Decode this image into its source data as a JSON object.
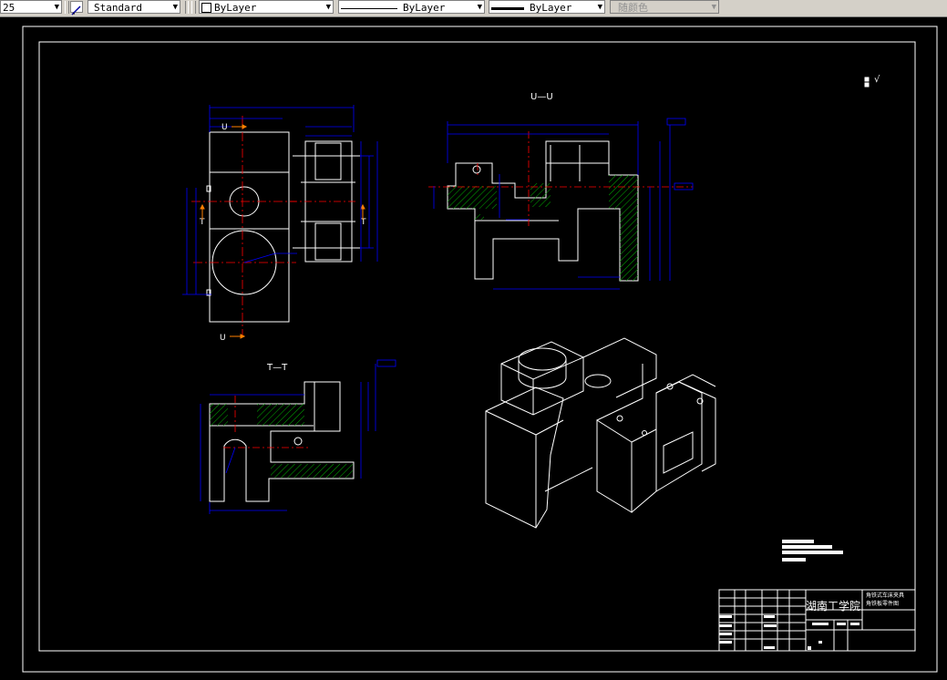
{
  "toolbar": {
    "scale_value": "25",
    "text_style": "Standard",
    "layer_color": "ByLayer",
    "linetype": "ByLayer",
    "lineweight": "ByLayer",
    "plot_style": "随颜色"
  },
  "drawing": {
    "section_uu_label": "U—U",
    "section_tt_label": "T—T",
    "cut_u_top": "U",
    "cut_u_bottom": "U",
    "cut_t_left": "T",
    "cut_t_right": "T",
    "title_block": {
      "school": "湖南工学院",
      "drawing_title_line1": "角铁式车床夹具",
      "drawing_title_line2": "角铁板零件图"
    },
    "roughness_mark": "√"
  },
  "colors": {
    "background": "#000000",
    "outline": "#ffffff",
    "dimension": "#0000ff",
    "centerline": "#ff0000",
    "hatch": "#00b000",
    "cut_arrow": "#ff8000"
  }
}
